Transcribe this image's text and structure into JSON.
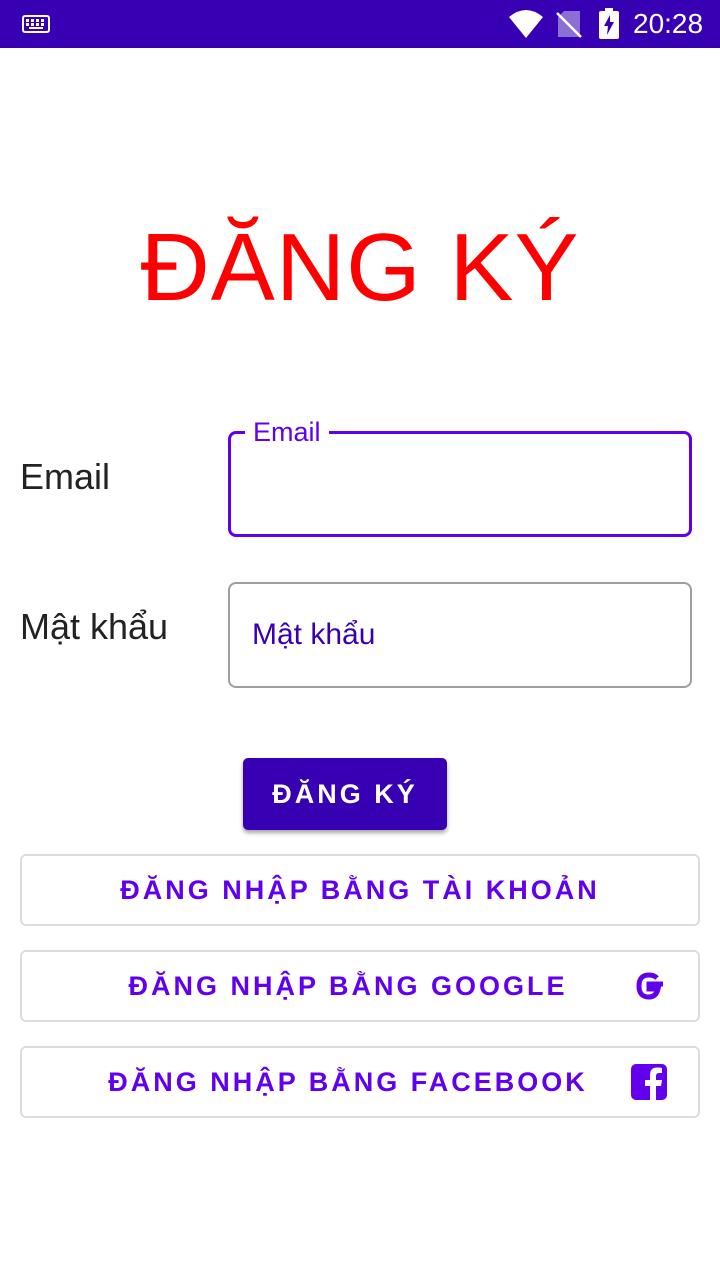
{
  "status_bar": {
    "time": "20:28",
    "icons": [
      "keyboard-icon",
      "wifi-icon",
      "no-sim-icon",
      "battery-charging-icon"
    ]
  },
  "page": {
    "title": "ĐĂNG KÝ"
  },
  "form": {
    "email_label": "Email",
    "email_floating_label": "Email",
    "email_value": "",
    "password_label": "Mật khẩu",
    "password_placeholder": "Mật khẩu",
    "password_value": ""
  },
  "buttons": {
    "register": "ĐĂNG KÝ",
    "login_account": "ĐĂNG NHẬP BẰNG TÀI KHOẢN",
    "login_google": "ĐĂNG NHẬP BẰNG GOOGLE",
    "login_facebook": "ĐĂNG NHẬP BẰNG FACEBOOK"
  },
  "colors": {
    "primary_dark": "#3700b3",
    "primary": "#6200ee",
    "title_red": "#ff0000",
    "outline_gray": "#dcdcdc"
  }
}
